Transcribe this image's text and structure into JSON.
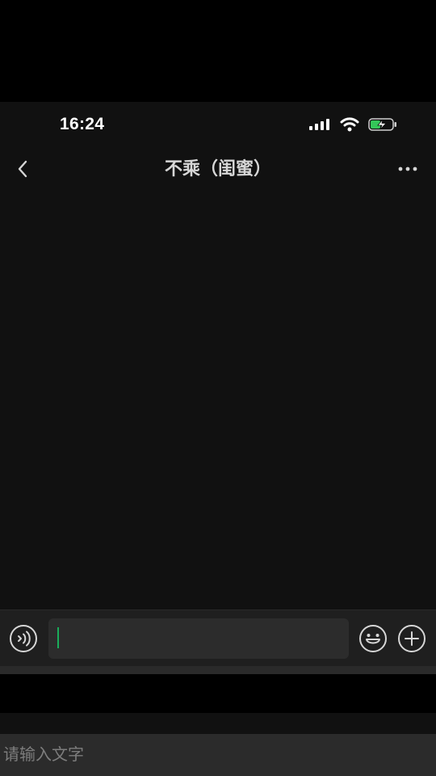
{
  "status_bar": {
    "time": "16:24",
    "icons": [
      "signal-icon",
      "wifi-icon",
      "battery-charging-icon"
    ],
    "battery_color": "#34c759"
  },
  "nav": {
    "back_icon": "chevron-left-icon",
    "title": "不乘（闺蜜）",
    "more_icon": "ellipsis-icon"
  },
  "input_bar": {
    "voice_icon": "voice-icon",
    "emoji_icon": "emoji-icon",
    "plus_icon": "plus-icon",
    "cursor_color": "#1aad5a",
    "text": ""
  },
  "ime": {
    "placeholder": "请输入文字"
  }
}
